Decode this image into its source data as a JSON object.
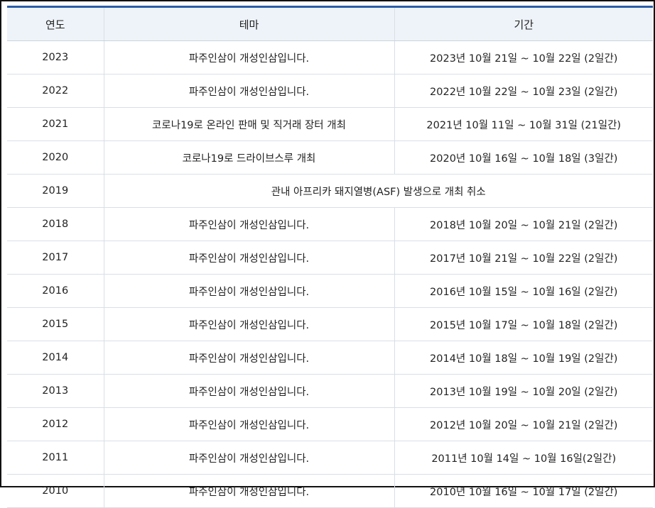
{
  "table": {
    "headers": [
      "연도",
      "테마",
      "기간"
    ],
    "rows": [
      {
        "year": "2023",
        "theme": "파주인삼이 개성인삼입니다.",
        "period": "2023년 10월 21일 ~ 10월 22일 (2일간)"
      },
      {
        "year": "2022",
        "theme": "파주인삼이 개성인삼입니다.",
        "period": "2022년 10월 22일 ~ 10월 23일 (2일간)"
      },
      {
        "year": "2021",
        "theme": "코로나19로 온라인 판매 및 직거래 장터 개최",
        "period": "2021년 10월 11일 ~ 10월 31일 (21일간)"
      },
      {
        "year": "2020",
        "theme": "코로나19로 드라이브스루 개최",
        "period": "2020년 10월 16일 ~ 10월 18일 (3일간)"
      },
      {
        "year": "2019",
        "merged": "관내 아프리카 돼지열병(ASF) 발생으로 개최 취소"
      },
      {
        "year": "2018",
        "theme": "파주인삼이 개성인삼입니다.",
        "period": "2018년 10월 20일 ~ 10월 21일 (2일간)"
      },
      {
        "year": "2017",
        "theme": "파주인삼이 개성인삼입니다.",
        "period": "2017년 10월 21일 ~ 10월 22일 (2일간)"
      },
      {
        "year": "2016",
        "theme": "파주인삼이 개성인삼입니다.",
        "period": "2016년 10월 15일 ~ 10월 16일 (2일간)"
      },
      {
        "year": "2015",
        "theme": "파주인삼이 개성인삼입니다.",
        "period": "2015년 10월 17일 ~ 10월 18일 (2일간)"
      },
      {
        "year": "2014",
        "theme": "파주인삼이 개성인삼입니다.",
        "period": "2014년 10월 18일 ~ 10월 19일 (2일간)"
      },
      {
        "year": "2013",
        "theme": "파주인삼이 개성인삼입니다.",
        "period": "2013년 10월 19일 ~ 10월 20일 (2일간)"
      },
      {
        "year": "2012",
        "theme": "파주인삼이 개성인삼입니다.",
        "period": "2012년 10월 20일 ~ 10월 21일 (2일간)"
      },
      {
        "year": "2011",
        "theme": "파주인삼이 개성인삼입니다.",
        "period": "2011년 10월 14일 ~ 10월 16일(2일간)"
      },
      {
        "year": "2010",
        "theme": "파주인삼이 개성인삼입니다.",
        "period": "2010년 10월 16일 ~ 10월 17일 (2일간)"
      }
    ]
  },
  "colors": {
    "header_bg": "#eef3f9",
    "top_rule": "#2a5ea8",
    "grid_line": "#d9dfe6",
    "text": "#222222"
  }
}
